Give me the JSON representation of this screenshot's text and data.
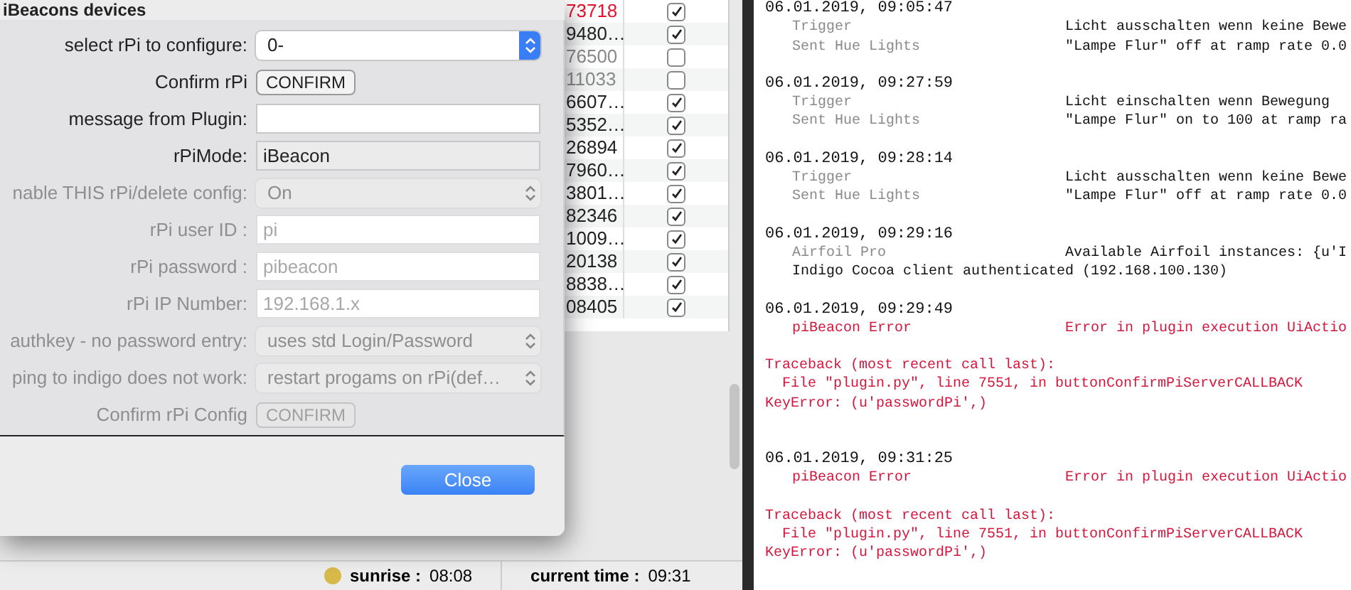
{
  "dialog": {
    "title": "iBeacons devices",
    "rows": [
      {
        "label": "select rPi to configure:",
        "kind": "select",
        "value": "0-",
        "disabled": false
      },
      {
        "label": "Confirm rPi",
        "kind": "button",
        "value": "CONFIRM",
        "disabled": false
      },
      {
        "label": "message from Plugin:",
        "kind": "input",
        "value": "",
        "disabled": false
      },
      {
        "label": "rPiMode:",
        "kind": "readonly",
        "value": "iBeacon",
        "disabled": false
      },
      {
        "label": "nable THIS rPi/delete config:",
        "kind": "select",
        "value": "On",
        "disabled": true
      },
      {
        "label": "rPi user ID :",
        "kind": "input",
        "value": "pi",
        "disabled": true
      },
      {
        "label": "rPi password :",
        "kind": "input",
        "value": "pibeacon",
        "disabled": true
      },
      {
        "label": "rPi IP Number:",
        "kind": "input",
        "value": "192.168.1.x",
        "disabled": true
      },
      {
        "label": "authkey - no password entry:",
        "kind": "select",
        "value": "uses std Login/Password",
        "disabled": true
      },
      {
        "label": "ping to indigo does not work:",
        "kind": "select",
        "value": "restart progams on rPi(def…",
        "disabled": true
      },
      {
        "label": "Confirm rPi Config",
        "kind": "button",
        "value": "CONFIRM",
        "disabled": true
      }
    ],
    "close_button": "Close"
  },
  "table": {
    "rows": [
      {
        "id": "73718",
        "checked": true,
        "color": "#e8102a"
      },
      {
        "id": "9480…",
        "checked": true,
        "color": "#222222"
      },
      {
        "id": "76500",
        "checked": false,
        "color": "#8a8a8a"
      },
      {
        "id": "11033",
        "checked": false,
        "color": "#8a8a8a"
      },
      {
        "id": "6607…",
        "checked": true,
        "color": "#222222"
      },
      {
        "id": "5352…",
        "checked": true,
        "color": "#222222"
      },
      {
        "id": "26894",
        "checked": true,
        "color": "#222222"
      },
      {
        "id": "7960…",
        "checked": true,
        "color": "#222222"
      },
      {
        "id": "3801…",
        "checked": true,
        "color": "#222222"
      },
      {
        "id": "82346",
        "checked": true,
        "color": "#222222"
      },
      {
        "id": "1009…",
        "checked": true,
        "color": "#222222"
      },
      {
        "id": "20138",
        "checked": true,
        "color": "#222222"
      },
      {
        "id": "8838…",
        "checked": true,
        "color": "#222222"
      },
      {
        "id": "08405",
        "checked": true,
        "color": "#222222"
      }
    ]
  },
  "status_bar": {
    "sunrise_label": "sunrise :",
    "sunrise": "08:08",
    "time_label": "current time :",
    "time": "09:31"
  },
  "log": [
    {
      "date": "06.01.2019, 09:05:47",
      "lines": [
        {
          "kind": "info",
          "source": "Trigger",
          "message": "Licht ausschalten wenn keine Bewe"
        },
        {
          "kind": "info",
          "source": "Sent Hue Lights",
          "message": "\"Lampe Flur\" off at ramp rate 0.0"
        }
      ]
    },
    {
      "date": "06.01.2019, 09:27:59",
      "lines": [
        {
          "kind": "info",
          "source": "Trigger",
          "message": "Licht einschalten wenn Bewegung"
        },
        {
          "kind": "info",
          "source": "Sent Hue Lights",
          "message": "\"Lampe Flur\" on to 100 at ramp ra"
        }
      ]
    },
    {
      "date": "06.01.2019, 09:28:14",
      "lines": [
        {
          "kind": "info",
          "source": "Trigger",
          "message": "Licht ausschalten wenn keine Bewe"
        },
        {
          "kind": "info",
          "source": "Sent Hue Lights",
          "message": "\"Lampe Flur\" off at ramp rate 0.0"
        }
      ]
    },
    {
      "date": "06.01.2019, 09:29:16",
      "lines": [
        {
          "kind": "info",
          "source": "Airfoil Pro",
          "message": "Available Airfoil instances: {u'I"
        },
        {
          "kind": "plain",
          "message": "Indigo Cocoa client authenticated (192.168.100.130)"
        }
      ]
    },
    {
      "date": "06.01.2019, 09:29:49",
      "lines": [
        {
          "kind": "error",
          "source": "piBeacon Error",
          "message": "Error in plugin execution UiActio"
        }
      ],
      "traceback": [
        "Traceback (most recent call last):",
        "  File \"plugin.py\", line 7551, in buttonConfirmPiServerCALLBACK",
        "KeyError: (u'passwordPi',)"
      ]
    },
    {
      "date": "06.01.2019, 09:31:25",
      "lines": [
        {
          "kind": "error",
          "source": "piBeacon Error",
          "message": "Error in plugin execution UiActio"
        }
      ],
      "traceback": [
        "Traceback (most recent call last):",
        "  File \"plugin.py\", line 7551, in buttonConfirmPiServerCALLBACK",
        "KeyError: (u'passwordPi',)"
      ]
    }
  ]
}
